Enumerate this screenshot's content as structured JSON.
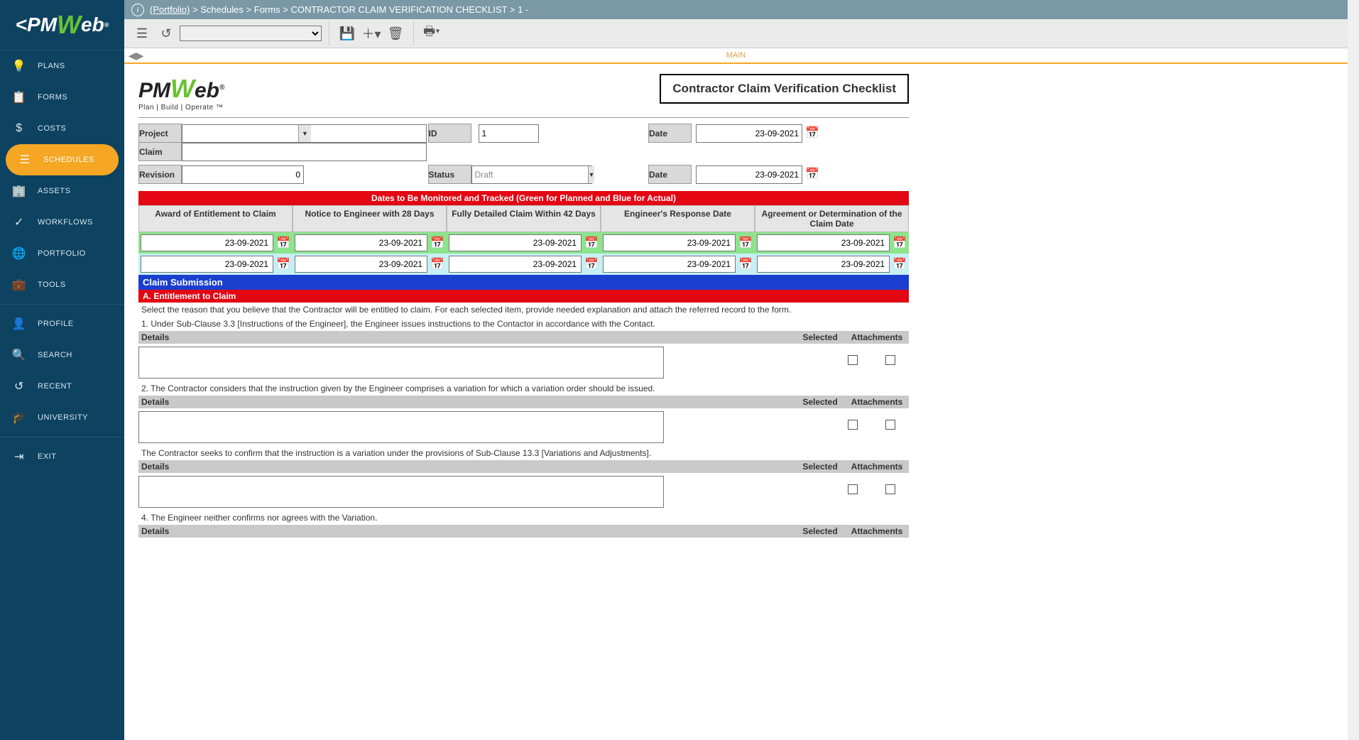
{
  "breadcrumb": {
    "root": "(Portfolio)",
    "sep": " > ",
    "p1": "Schedules",
    "p2": "Forms",
    "p3": "CONTRACTOR CLAIM VERIFICATION CHECKLIST",
    "p4": "1 -"
  },
  "tab": {
    "main": "MAIN"
  },
  "sidebar": {
    "items": [
      {
        "label": "PLANS"
      },
      {
        "label": "FORMS"
      },
      {
        "label": "COSTS"
      },
      {
        "label": "SCHEDULES"
      },
      {
        "label": "ASSETS"
      },
      {
        "label": "WORKFLOWS"
      },
      {
        "label": "PORTFOLIO"
      },
      {
        "label": "TOOLS"
      },
      {
        "label": "PROFILE"
      },
      {
        "label": "SEARCH"
      },
      {
        "label": "RECENT"
      },
      {
        "label": "UNIVERSITY"
      },
      {
        "label": "EXIT"
      }
    ]
  },
  "logo": {
    "pm": "PM",
    "w": "W",
    "eb": "eb",
    "reg": "®",
    "sub": "Plan | Build | Operate ™"
  },
  "form": {
    "title": "Contractor Claim Verification Checklist",
    "labels": {
      "project": "Project",
      "id": "ID",
      "date": "Date",
      "claim": "Claim",
      "revision": "Revision",
      "status": "Status",
      "date2": "Date"
    },
    "values": {
      "project": "",
      "id": "1",
      "date": "23-09-2021",
      "claim": "",
      "revision": "0",
      "status": "Draft",
      "date2": "23-09-2021"
    },
    "banner_red": "Dates to Be Monitored and Tracked (Green for Planned and Blue for Actual)",
    "columns": [
      "Award of Entitlement to Claim",
      "Notice to Engineer with 28 Days",
      "Fully Detailed Claim Within 42 Days",
      "Engineer's Response Date",
      "Agreement or Determination of the Claim Date"
    ],
    "dates_planned": [
      "23-09-2021",
      "23-09-2021",
      "23-09-2021",
      "23-09-2021",
      "23-09-2021"
    ],
    "dates_actual": [
      "23-09-2021",
      "23-09-2021",
      "23-09-2021",
      "23-09-2021",
      "23-09-2021"
    ],
    "banner_blue": "Claim Submission",
    "banner_ent": "A. Entitlement to Claim",
    "ent_instr": "Select the reason that you believe that the Contractor will be entitled to claim. For each selected item, provide needed explanation and attach the referred record to the form.",
    "items": [
      "1. Under Sub-Clause 3.3 [Instructions of the Engineer], the Engineer issues instructions to the Contactor in accordance with the Contact.",
      "2. The Contractor considers that the instruction given by the Engineer comprises a variation for which a variation order should be issued.",
      "The Contractor seeks to confirm that the instruction is a variation under the provisions of Sub-Clause 13.3 [Variations and Adjustments].",
      "4. The Engineer neither confirms nor agrees with the Variation."
    ],
    "dheaders": {
      "details": "Details",
      "selected": "Selected",
      "attach": "Attachments"
    }
  }
}
